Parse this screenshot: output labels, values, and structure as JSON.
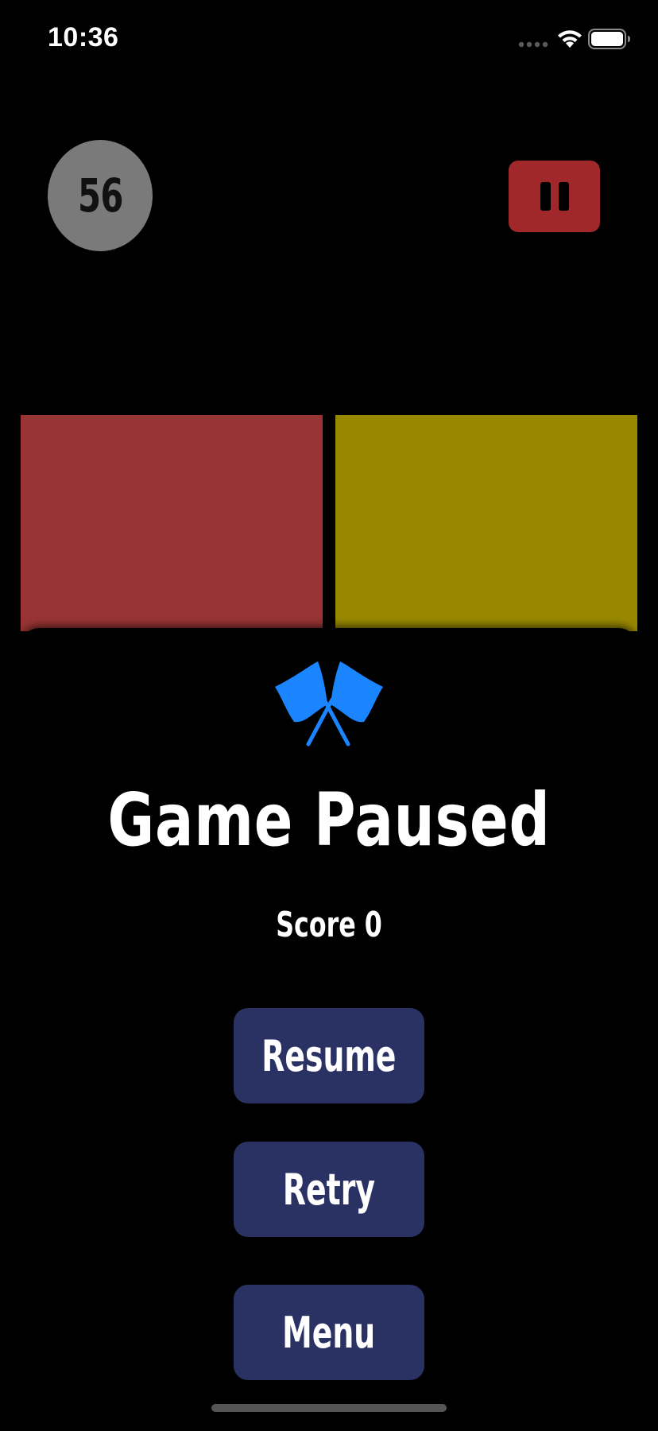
{
  "status_bar": {
    "time": "10:36",
    "signal_icon": "cellular-dots-icon",
    "wifi_icon": "wifi-icon",
    "battery_icon": "battery-full-icon"
  },
  "game": {
    "timer_value": "56",
    "pause_icon": "pause-icon",
    "tiles": [
      {
        "color_name": "red",
        "color": "#983434"
      },
      {
        "color_name": "yellow",
        "color": "#988800"
      }
    ]
  },
  "pause_dialog": {
    "icon": "checkered-flags-icon",
    "accent_color": "#1a85ff",
    "title": "Game Paused",
    "score_text": "Score 0",
    "buttons": {
      "resume": "Resume",
      "retry": "Retry",
      "menu": "Menu"
    },
    "button_color": "#2a3264"
  }
}
